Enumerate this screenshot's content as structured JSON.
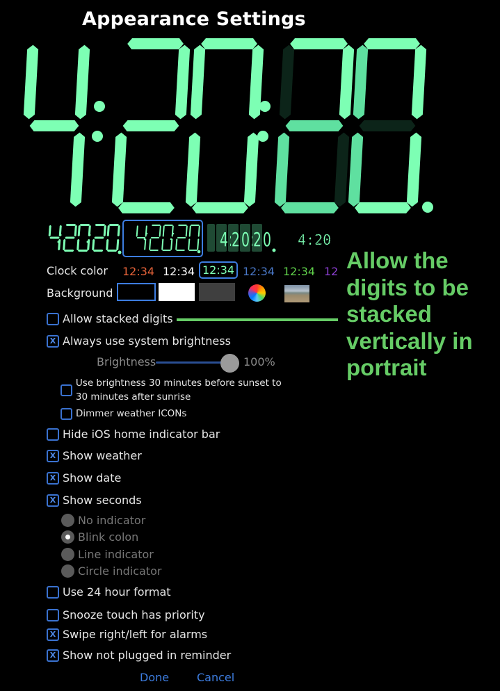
{
  "title": "Appearance Settings",
  "clock": {
    "display_time": "4:20:20.",
    "digits": [
      "4",
      "2",
      "0",
      "2",
      "0"
    ],
    "digit_color": "#7dffb4",
    "dim_digit_color": "#5fe0a0",
    "off_segment_color": "#0c2419"
  },
  "previews": [
    {
      "name": "thin-seven-segment",
      "text": "4:20:20.",
      "selected": false
    },
    {
      "name": "stacked-seven-segment",
      "text": "4:20:20.",
      "selected": true
    },
    {
      "name": "flip-tile",
      "text": "4:20:20.",
      "selected": false
    },
    {
      "name": "dot-matrix",
      "text": "4:20",
      "selected": false
    }
  ],
  "clock_color": {
    "label": "Clock color",
    "options": [
      {
        "text": "12:34",
        "color": "#e8643a",
        "selected": false
      },
      {
        "text": "12:34",
        "color": "#ffffff",
        "selected": false
      },
      {
        "text": "12:34",
        "color": "#7dffb4",
        "selected": true
      },
      {
        "text": "12:34",
        "color": "#4a78c8",
        "selected": false
      },
      {
        "text": "12:34",
        "color": "#5fcf4a",
        "selected": false
      },
      {
        "text": "12",
        "color": "#8b3fd0",
        "selected": false
      }
    ]
  },
  "background": {
    "label": "Background",
    "options": [
      {
        "name": "black",
        "color": "#000000",
        "selected": true
      },
      {
        "name": "white",
        "color": "#ffffff",
        "selected": false
      },
      {
        "name": "gray",
        "color": "#3f3f3f",
        "selected": false
      },
      {
        "name": "color-picker",
        "selected": false
      },
      {
        "name": "photo",
        "selected": false
      }
    ]
  },
  "settings": {
    "allow_stacked_digits": {
      "label": "Allow stacked digits",
      "checked": false
    },
    "always_system_brightness": {
      "label": "Always use system brightness",
      "checked": true
    },
    "brightness": {
      "label": "Brightness",
      "value_text": "100%",
      "value": 1.0
    },
    "sunset_brightness": {
      "label": "Use brightness 30 minutes before sunset to 30 minutes after sunrise",
      "checked": false
    },
    "dimmer_weather": {
      "label": "Dimmer weather ICONs",
      "checked": false
    },
    "hide_home_indicator": {
      "label": "Hide iOS home indicator bar",
      "checked": false
    },
    "show_weather": {
      "label": "Show weather",
      "checked": true
    },
    "show_date": {
      "label": "Show date",
      "checked": true
    },
    "show_seconds": {
      "label": "Show seconds",
      "checked": true
    },
    "seconds_indicator": {
      "options": [
        {
          "label": "No indicator",
          "selected": false
        },
        {
          "label": "Blink colon",
          "selected": true
        },
        {
          "label": "Line indicator",
          "selected": false
        },
        {
          "label": "Circle indicator",
          "selected": false
        }
      ]
    },
    "use_24_hour": {
      "label": "Use 24 hour format",
      "checked": false
    },
    "snooze_priority": {
      "label": "Snooze touch has priority",
      "checked": false
    },
    "swipe_alarms": {
      "label": "Swipe right/left for alarms",
      "checked": true
    },
    "not_plugged_reminder": {
      "label": "Show not plugged in reminder",
      "checked": true
    }
  },
  "annotation": {
    "text": "Allow the digits to be stacked vertically in portrait",
    "color": "#66cc66"
  },
  "buttons": {
    "done": "Done",
    "cancel": "Cancel"
  },
  "check_mark": "X"
}
